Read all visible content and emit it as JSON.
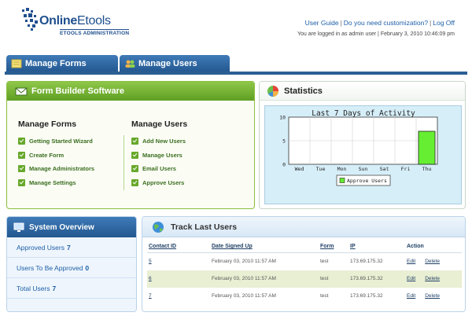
{
  "header": {
    "logo_text_strong": "Online",
    "logo_text_rest": "Etools",
    "logo_sub": "ETOOLS ADMINISTRATION",
    "links": [
      "User Guide",
      "Do you need customization?",
      "Log Off"
    ],
    "login_info": "You are logged in as admin user | February 3, 2010 10:46:09 pm"
  },
  "tabs": [
    {
      "label": "Manage Forms",
      "icon": "form-icon"
    },
    {
      "label": "Manage Users",
      "icon": "users-icon"
    }
  ],
  "form_builder": {
    "title": "Form Builder Software",
    "forms_title": "Manage Forms",
    "forms_items": [
      "Getting Started Wizard",
      "Create Form",
      "Manage Administrators",
      "Manage Settings"
    ],
    "users_title": "Manage Users",
    "users_items": [
      "Add New Users",
      "Manage Users",
      "Email Users",
      "Approve Users"
    ]
  },
  "statistics": {
    "title": "Statistics"
  },
  "chart_data": {
    "type": "bar",
    "title": "Last 7 Days of Activity",
    "categories": [
      "Wed",
      "Tue",
      "Mon",
      "Sun",
      "Sat",
      "Fri",
      "Thu"
    ],
    "series": [
      {
        "name": "Approve Users",
        "values": [
          0,
          0,
          0,
          0,
          0,
          0,
          7
        ],
        "color": "#66ee33"
      }
    ],
    "ylim": [
      0,
      10
    ],
    "yticks": [
      0,
      5,
      10
    ],
    "grid": true,
    "legend": "bottom-center"
  },
  "system_overview": {
    "title": "System Overview",
    "rows": [
      {
        "label": "Approved Users",
        "value": "7"
      },
      {
        "label": "Users To Be Approved",
        "value": "0"
      },
      {
        "label": "Total Users",
        "value": "7"
      }
    ]
  },
  "track_users": {
    "title": "Track Last Users",
    "columns": [
      "Contact ID",
      "Date Signed Up",
      "Form",
      "IP",
      "Action"
    ],
    "rows": [
      {
        "id": "5",
        "date": "February 03, 2010 11:57 AM",
        "form": "test",
        "ip": "173.69.175.32",
        "edit": "Edit",
        "delete": "Delete"
      },
      {
        "id": "6",
        "date": "February 03, 2010 11:57 AM",
        "form": "test",
        "ip": "173.69.175.32",
        "edit": "Edit",
        "delete": "Delete"
      },
      {
        "id": "7",
        "date": "February 03, 2010 11:57 AM",
        "form": "test",
        "ip": "173.69.175.32",
        "edit": "Edit",
        "delete": "Delete"
      }
    ]
  },
  "colors": {
    "brand_blue": "#2b5f94",
    "accent_green": "#67a82b",
    "chart_bg": "#d6eef8"
  }
}
